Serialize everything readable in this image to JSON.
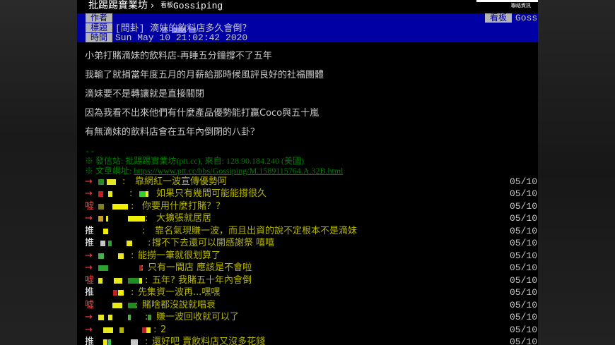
{
  "topbar": {
    "site_name": "批踢踢實業坊",
    "separator": "›",
    "board_label": "看板",
    "board_name": "Gossiping",
    "contact": "聯絡資訊"
  },
  "header": {
    "author_label": "作者",
    "title_label": "標題",
    "time_label": "時間",
    "board_label": "看板",
    "board_value": "Gossi",
    "title": "[問卦] 滴妹的飲料店多久會倒？",
    "time": "Sun May 10 21:02:42 2020"
  },
  "body_lines": [
    "小弟打賭滴妹的飲料店-再睡五分鐘撐不了五年",
    "我輸了就捐當年度五月的月薪給那時候風評良好的社福團體",
    "滴妹要不是轉讓就是直接關閉",
    "因為我看不出來他們有什麼產品優勢能打贏Coco與五十嵐",
    "有無滴妹的飲料店會在五年內倒閉的八卦？"
  ],
  "separator": "--",
  "source": {
    "line1": "※ 發信站: 批踢踢實業坊(ptt.cc), 來自: 128.90.184.240 (美國)",
    "line2_prefix": "※ 文章網址: ",
    "url": "https://www.ptt.cc/bbs/Gossiping/M.1589115764.A.32B.html"
  },
  "comments": [
    {
      "tag": "→",
      "text": "靠網紅一波宣傳優勢阿",
      "date": "05/10"
    },
    {
      "tag": "→",
      "text": "如果只有幾間可能能撐很久",
      "date": "05/10"
    },
    {
      "tag": "噓",
      "text": "你要用什麼打賭？？",
      "date": "05/10"
    },
    {
      "tag": "→",
      "text": "大擴張就居居",
      "date": "05/10"
    },
    {
      "tag": "推",
      "text": "靠名氣現賺一波，而且出資的說不定根本不是滴妹",
      "date": "05/10"
    },
    {
      "tag": "推",
      "text": "撐不下去還可以開感謝祭 嘻嘻",
      "date": "05/10"
    },
    {
      "tag": "→",
      "text": "能撈一筆就很划算了",
      "date": "05/10"
    },
    {
      "tag": "→",
      "text": "只有一間店 應該是不會啦",
      "date": "05/10"
    },
    {
      "tag": "噓",
      "text": "五年? 我賭五十年內會倒",
      "date": "05/10"
    },
    {
      "tag": "推",
      "text": "先集資一波再...嘿嘿",
      "date": "05/10"
    },
    {
      "tag": "噓",
      "text": "賭啥都沒說就唱衰",
      "date": "05/10"
    },
    {
      "tag": "→",
      "text": "賺一波回收就可以了",
      "date": "05/10"
    },
    {
      "tag": "→",
      "text": "2",
      "date": "05/10"
    },
    {
      "tag": "推",
      "text": "還好吧 賣飲料店又沒多花錢",
      "date": "05/10"
    }
  ]
}
